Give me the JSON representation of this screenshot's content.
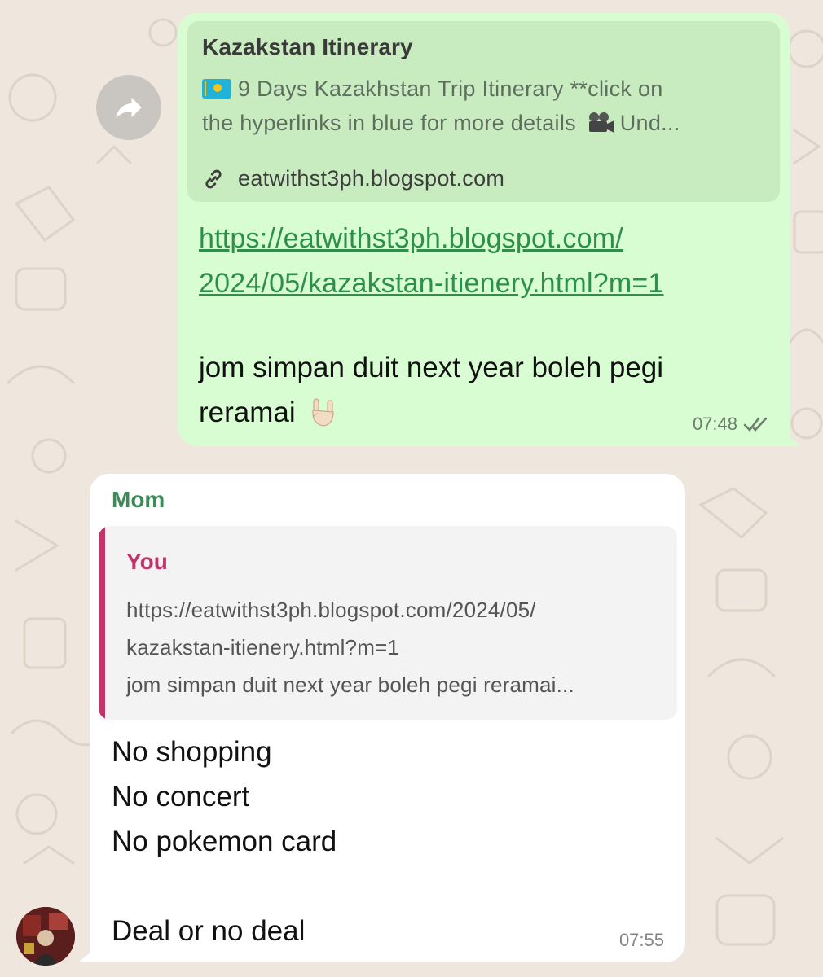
{
  "outgoing_message": {
    "link_preview": {
      "title": "Kazakstan Itinerary",
      "description_line1": "9 Days Kazakhstan Trip Itinerary **click on",
      "description_line2_a": "the hyperlinks in blue for more details",
      "description_line2_b": "Und...",
      "domain": "eatwithst3ph.blogspot.com"
    },
    "link_line1": "https://eatwithst3ph.blogspot.com/",
    "link_line2": "2024/05/kazakstan-itienery.html?m=1",
    "body_line1": "jom simpan duit next year boleh pegi",
    "body_line2": "reramai",
    "time": "07:48",
    "status": "read",
    "icons": [
      "forward-icon",
      "kazakhstan-flag-icon",
      "movie-camera-icon",
      "link-icon",
      "rock-on-hand-icon",
      "double-check-icon"
    ]
  },
  "incoming_message": {
    "sender": "Mom",
    "quoted": {
      "author": "You",
      "line1": "https://eatwithst3ph.blogspot.com/2024/05/",
      "line2": "kazakstan-itienery.html?m=1",
      "line3": "jom simpan duit next year boleh pegi reramai..."
    },
    "lines": [
      "No shopping",
      "No concert",
      "No pokemon card",
      "",
      "Deal or no deal"
    ],
    "time": "07:55"
  },
  "colors": {
    "chat_background": "#efe7dd",
    "outgoing_bubble": "#d9fdd3",
    "incoming_bubble": "#ffffff",
    "link": "#2e8f4a",
    "sender_name": "#3b8a57",
    "quote_accent": "#c2346a"
  }
}
